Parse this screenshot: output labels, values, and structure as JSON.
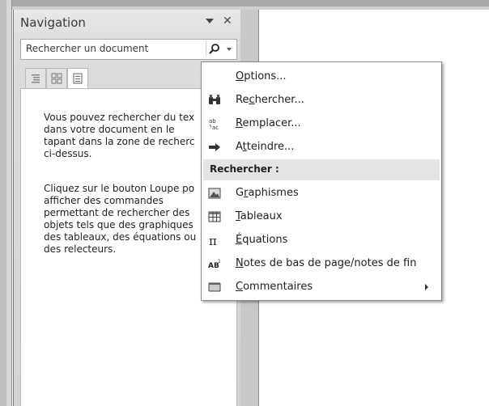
{
  "nav": {
    "title": "Navigation",
    "search_placeholder": "Rechercher un document",
    "tabs": [
      "headings-tab",
      "pages-tab",
      "results-tab"
    ],
    "help_paragraph_1": "Vous pouvez rechercher du tex\ndans votre document en le\ntapant dans la zone de recherc\nci-dessus.",
    "help_paragraph_2": "Cliquez sur le bouton Loupe po\nafficher des commandes\npermettant de rechercher des\nobjets tels que des graphiques\ndes tableaux, des équations ou\ndes relecteurs."
  },
  "menu": {
    "items_top": [
      {
        "pre": "",
        "u": "O",
        "post": "ptions...",
        "icon": "none"
      },
      {
        "pre": "Re",
        "u": "c",
        "post": "hercher...",
        "icon": "binoculars-icon"
      },
      {
        "pre": "",
        "u": "R",
        "post": "emplacer...",
        "icon": "replace-icon"
      },
      {
        "pre": "A",
        "u": "t",
        "post": "teindre...",
        "icon": "goto-arrow-icon"
      }
    ],
    "section_label": "Rechercher :",
    "items_bottom": [
      {
        "pre": "G",
        "u": "r",
        "post": "aphismes",
        "icon": "graphics-icon"
      },
      {
        "pre": "",
        "u": "T",
        "post": "ableaux",
        "icon": "table-icon"
      },
      {
        "pre": "",
        "u": "É",
        "post": "quations",
        "icon": "pi-icon"
      },
      {
        "pre": "",
        "u": "N",
        "post": "otes de bas de page/notes de fin",
        "icon": "footnote-icon"
      },
      {
        "pre": "",
        "u": "C",
        "post": "ommentaires",
        "icon": "comment-icon",
        "has_submenu": true
      }
    ]
  }
}
